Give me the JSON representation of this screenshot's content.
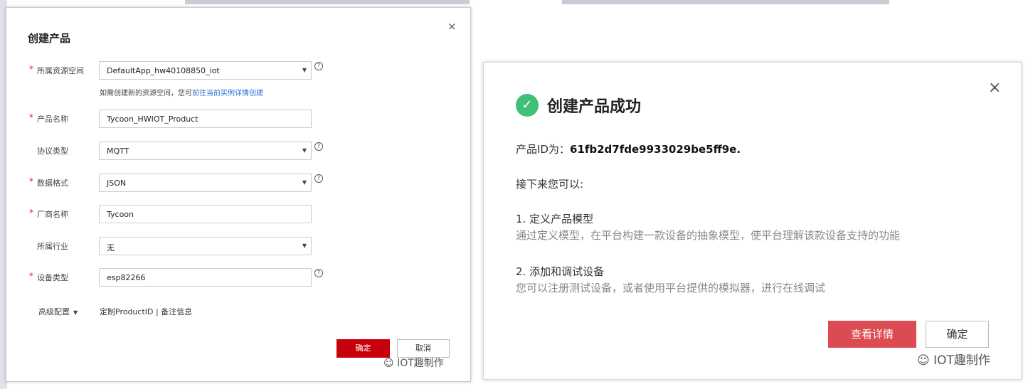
{
  "left_dialog": {
    "title": "创建产品",
    "close": "×",
    "fields": {
      "resource_space": {
        "label": "所属资源空间",
        "value": "DefaultApp_hw40108850_iot",
        "required": true
      },
      "product_name": {
        "label": "产品名称",
        "value": "Tycoon_HWIOT_Product",
        "required": true
      },
      "protocol": {
        "label": "协议类型",
        "value": "MQTT",
        "required": false
      },
      "data_format": {
        "label": "数据格式",
        "value": "JSON",
        "required": true
      },
      "vendor": {
        "label": "厂商名称",
        "value": "Tycoon",
        "required": true
      },
      "industry": {
        "label": "所属行业",
        "value": "无",
        "required": false
      },
      "device_type": {
        "label": "设备类型",
        "value": "esp82266",
        "required": true
      }
    },
    "hint_prefix": "如需创建新的资源空间，您可",
    "hint_link": "前往当前实例详情创建",
    "advanced_label": "高级配置",
    "advanced_links": "定制ProductID | 备注信息",
    "ok_label": "确定",
    "cancel_label": "取消",
    "watermark": "IOT趣制作"
  },
  "right_dialog": {
    "title": "创建产品成功",
    "close": "×",
    "product_id_label": "产品ID为：",
    "product_id": "61fb2d7fde9933029be5ff9e.",
    "next_label": "接下来您可以:",
    "step1_title": "1. 定义产品模型",
    "step1_desc": "通过定义模型，在平台构建一款设备的抽象模型，使平台理解该款设备支持的功能",
    "step2_title": "2. 添加和调试设备",
    "step2_desc": "您可以注册测试设备，或者使用平台提供的模拟器，进行在线调试",
    "detail_label": "查看详情",
    "ok_label": "确定",
    "watermark": "IOT趣制作"
  },
  "icons": {
    "success": "check-circle-icon",
    "help": "question-circle-icon",
    "wechat": "wechat-icon"
  },
  "colors": {
    "primary_red": "#c7000b",
    "detail_red": "#dc4b51",
    "success_green": "#3fbf78",
    "link_blue": "#2a6fd6",
    "required_red": "#e02020"
  }
}
